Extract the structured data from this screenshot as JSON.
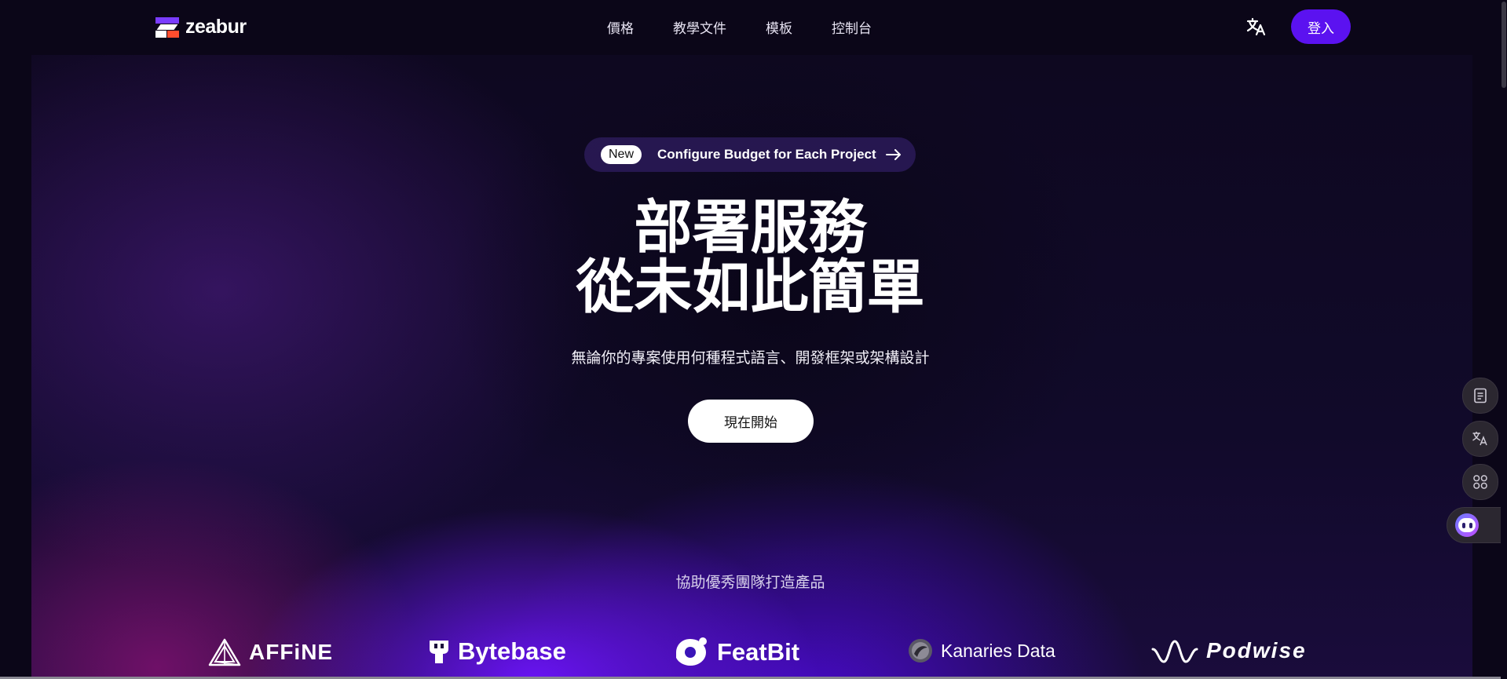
{
  "header": {
    "logo_text": "zeabur",
    "nav": [
      {
        "label": "價格"
      },
      {
        "label": "教學文件"
      },
      {
        "label": "模板"
      },
      {
        "label": "控制台"
      }
    ],
    "language_icon": "translate-icon",
    "login_label": "登入"
  },
  "announcement": {
    "badge": "New",
    "text": "Configure Budget for Each Project",
    "icon": "arrow-right-icon"
  },
  "hero": {
    "headline_line1": "部署服務",
    "headline_line2": "從未如此簡單",
    "subhead": "無論你的專案使用何種程式語言、開發框架或架構設計",
    "cta_label": "現在開始"
  },
  "customers": {
    "heading": "協助優秀團隊打造產品",
    "brands": [
      {
        "name": "AFFiNE",
        "icon": "affine-logo-icon"
      },
      {
        "name": "Bytebase",
        "icon": "bytebase-logo-icon"
      },
      {
        "name": "FeatBit",
        "icon": "featbit-logo-icon"
      },
      {
        "name": "Kanaries Data",
        "icon": "kanaries-logo-icon"
      },
      {
        "name": "Podwise",
        "icon": "podwise-logo-icon"
      }
    ]
  },
  "side_tools": [
    {
      "icon": "document-icon"
    },
    {
      "icon": "translate-icon"
    },
    {
      "icon": "apps-icon"
    },
    {
      "icon": "ai-assistant-icon"
    }
  ],
  "colors": {
    "background": "#0b0618",
    "accent": "#5b12f0",
    "glow_purple": "#6e14ff",
    "logo_orange": "#ff4d2e"
  }
}
